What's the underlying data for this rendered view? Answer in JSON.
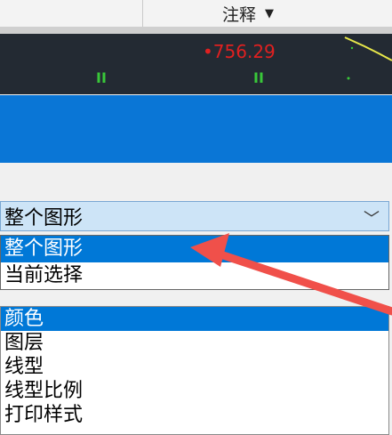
{
  "ribbon": {
    "annotation_label": "注释",
    "annotation_caret": "▼"
  },
  "viewport": {
    "value_text": "•756.29",
    "mark_glyph": "II"
  },
  "panel": {
    "scope_selected": "整个图形",
    "scope_chevron": "﹀",
    "scope_options": [
      {
        "label": "整个图形",
        "selected": true
      },
      {
        "label": "当前选择",
        "selected": false
      }
    ],
    "property_list": [
      {
        "label": "颜色",
        "selected": true
      },
      {
        "label": "图层",
        "selected": false
      },
      {
        "label": "线型",
        "selected": false
      },
      {
        "label": "线型比例",
        "selected": false
      },
      {
        "label": "打印样式",
        "selected": false
      }
    ]
  },
  "colors": {
    "accent_blue": "#0a76d6",
    "selection_blue": "#0078d7",
    "annotation_arrow": "#f0504a"
  }
}
